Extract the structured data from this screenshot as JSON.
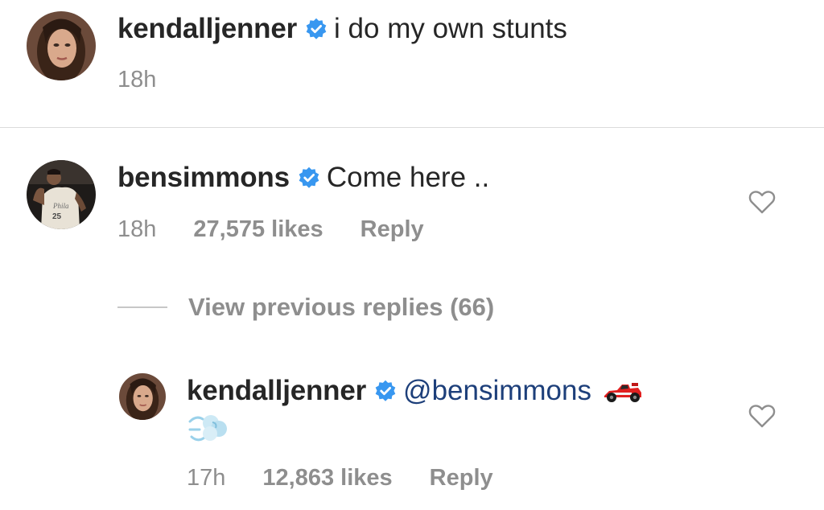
{
  "caption": {
    "username": "kendalljenner",
    "text": "i do my own stunts",
    "time": "18h"
  },
  "comment": {
    "username": "bensimmons",
    "text": "Come here ..",
    "time": "18h",
    "likes": "27,575 likes",
    "reply_label": "Reply"
  },
  "view_previous": {
    "label": "View previous replies (66)"
  },
  "reply": {
    "username": "kendalljenner",
    "mention": "@bensimmons",
    "time": "17h",
    "likes": "12,863 likes",
    "reply_label": "Reply",
    "emojis": [
      "racing-car-emoji",
      "dashing-away-emoji"
    ]
  },
  "icons": {
    "verified": "verified-badge-icon",
    "like": "heart-outline-icon"
  },
  "colors": {
    "verified_blue": "#3897f0",
    "primary_text": "#262626",
    "secondary_text": "#8e8e8e",
    "mention_blue": "#1d3f7a",
    "divider": "#dbdbdb"
  }
}
